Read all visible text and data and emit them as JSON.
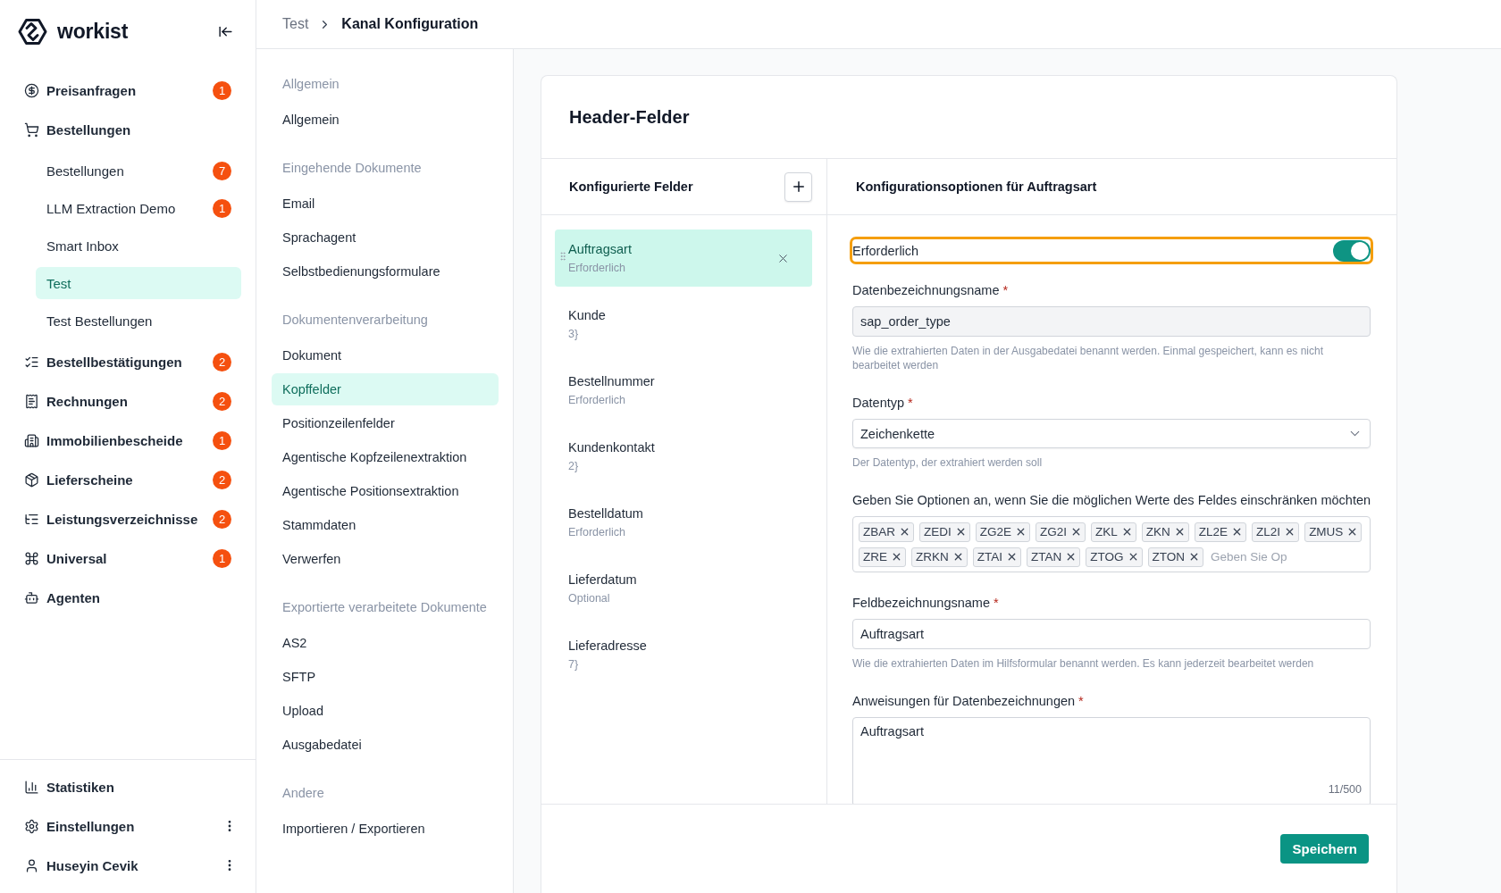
{
  "sidebar": {
    "logo_text": "workist",
    "nav": [
      {
        "kind": "item",
        "label": "Preisanfragen",
        "badge": "1",
        "selected": false
      },
      {
        "kind": "group",
        "label": "Bestellungen",
        "selected": false,
        "children": [
          {
            "label": "Bestellungen",
            "badge": "7",
            "selected": false
          },
          {
            "label": "LLM Extraction Demo",
            "badge": "1",
            "selected": false
          },
          {
            "label": "Smart Inbox",
            "selected": false
          },
          {
            "label": "Test",
            "selected": true
          },
          {
            "label": "Test Bestellungen",
            "selected": false
          }
        ]
      },
      {
        "kind": "item",
        "label": "Bestellbestätigungen",
        "badge": "2",
        "selected": false
      },
      {
        "kind": "item",
        "label": "Rechnungen",
        "badge": "2",
        "selected": false
      },
      {
        "kind": "item",
        "label": "Immobilienbescheide",
        "badge": "1",
        "selected": false
      },
      {
        "kind": "item",
        "label": "Lieferscheine",
        "badge": "2",
        "selected": false
      },
      {
        "kind": "item",
        "label": "Leistungsverzeichnisse",
        "badge": "2",
        "selected": false
      },
      {
        "kind": "item",
        "label": "Universal",
        "badge": "1",
        "selected": false
      },
      {
        "kind": "item",
        "label": "Agenten",
        "selected": false
      }
    ],
    "footer": [
      {
        "label": "Statistiken",
        "menu": false
      },
      {
        "label": "Einstellungen",
        "menu": true
      },
      {
        "label": "Huseyin Cevik",
        "menu": true
      }
    ]
  },
  "breadcrumb": [
    "Test",
    "Kanal Konfiguration"
  ],
  "settings_nav": [
    {
      "title": "Allgemein",
      "items": [
        {
          "label": "Allgemein",
          "selected": false
        }
      ]
    },
    {
      "title": "Eingehende Dokumente",
      "items": [
        {
          "label": "Email",
          "selected": false
        },
        {
          "label": "Sprachagent",
          "selected": false
        },
        {
          "label": "Selbstbedienungsformulare",
          "selected": false
        }
      ]
    },
    {
      "title": "Dokumentenverarbeitung",
      "items": [
        {
          "label": "Dokument",
          "selected": false
        },
        {
          "label": "Kopffelder",
          "selected": true
        },
        {
          "label": "Positionzeilenfelder",
          "selected": false
        },
        {
          "label": "Agentische Kopfzeilenextraktion",
          "selected": false
        },
        {
          "label": "Agentische Positionsextraktion",
          "selected": false
        },
        {
          "label": "Stammdaten",
          "selected": false
        },
        {
          "label": "Verwerfen",
          "selected": false
        }
      ]
    },
    {
      "title": "Exportierte verarbeitete Dokumente",
      "items": [
        {
          "label": "AS2",
          "selected": false
        },
        {
          "label": "SFTP",
          "selected": false
        },
        {
          "label": "Upload",
          "selected": false
        },
        {
          "label": "Ausgabedatei",
          "selected": false
        }
      ]
    },
    {
      "title": "Andere",
      "items": [
        {
          "label": "Importieren / Exportieren",
          "selected": false
        }
      ]
    }
  ],
  "card": {
    "title": "Header-Felder",
    "fields_panel": {
      "title": "Konfigurierte Felder",
      "fields": [
        {
          "name": "Auftragsart",
          "detail": "Erforderlich",
          "selected": true
        },
        {
          "name": "Kunde",
          "detail": "3}",
          "selected": false
        },
        {
          "name": "Bestellnummer",
          "detail": "Erforderlich",
          "selected": false
        },
        {
          "name": "Kundenkontakt",
          "detail": "2}",
          "selected": false
        },
        {
          "name": "Bestelldatum",
          "detail": "Erforderlich",
          "selected": false
        },
        {
          "name": "Lieferdatum",
          "detail": "Optional",
          "selected": false
        },
        {
          "name": "Lieferadresse",
          "detail": "7}",
          "selected": false
        }
      ]
    },
    "config_panel": {
      "title": "Konfigurationsoptionen für Auftragsart",
      "form": [
        {
          "kind": "toggle",
          "label": "Erforderlich",
          "on": true,
          "focused": true
        },
        {
          "kind": "text",
          "label": "Datenbezeichnungsname",
          "required_mark": "*",
          "value": "sap_order_type",
          "disabled": true,
          "help": "Wie die extrahierten Daten in der Ausgabedatei benannt werden. Einmal gespeichert, kann es nicht bearbeitet werden"
        },
        {
          "kind": "select",
          "label": "Datentyp",
          "required_mark": "*",
          "value": "Zeichenkette",
          "help": "Der Datentyp, der extrahiert werden soll"
        },
        {
          "kind": "tags",
          "label": "Geben Sie Optionen an, wenn Sie die möglichen Werte des Feldes einschränken möchten",
          "tags": [
            "ZBAR",
            "ZEDI",
            "ZG2E",
            "ZG2I",
            "ZKL",
            "ZKN",
            "ZL2E",
            "ZL2I",
            "ZMUS",
            "ZRE",
            "ZRKN",
            "ZTAI",
            "ZTAN",
            "ZTOG",
            "ZTON"
          ],
          "placeholder": "Geben Sie Op"
        },
        {
          "kind": "text",
          "label": "Feldbezeichnungsname",
          "required_mark": "*",
          "value": "Auftragsart",
          "disabled": false,
          "help": "Wie die extrahierten Daten im Hilfsformular benannt werden. Es kann jederzeit bearbeitet werden"
        },
        {
          "kind": "textarea",
          "label": "Anweisungen für Datenbezeichnungen",
          "required_mark": "*",
          "value": "Auftragsart",
          "counter": "11/500"
        }
      ]
    },
    "save_button": "Speichern"
  }
}
